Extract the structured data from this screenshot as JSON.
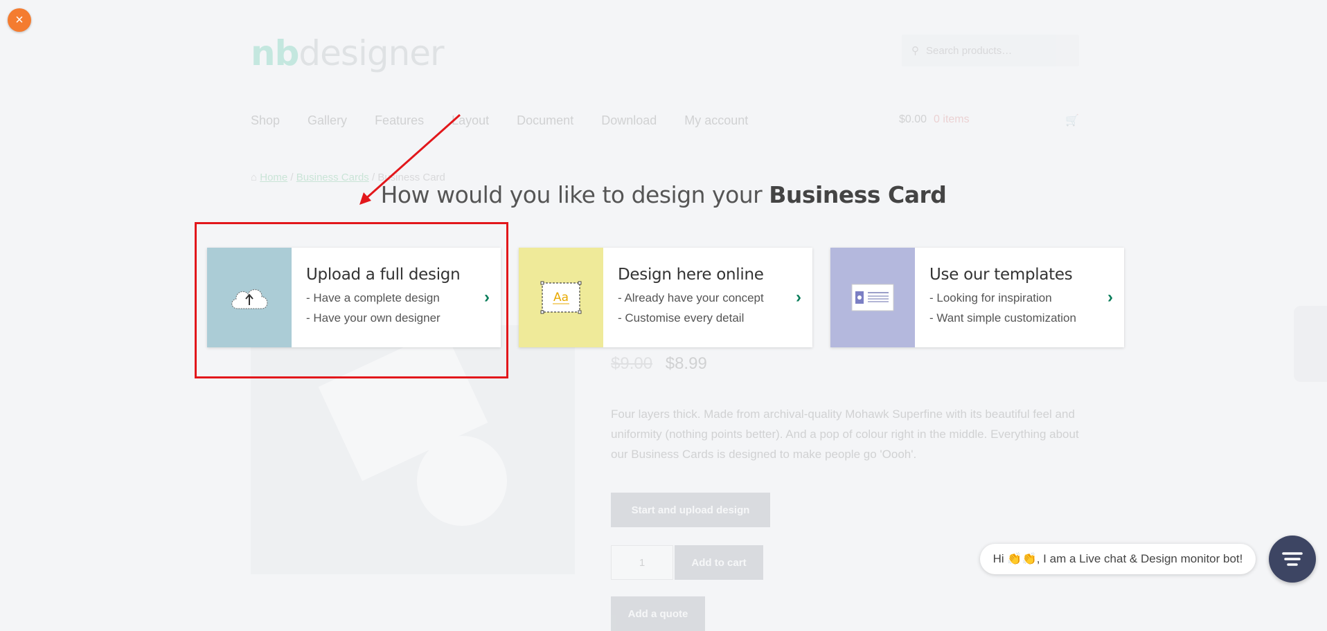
{
  "background_page": {
    "logo_mark": "nb",
    "logo_word": "designer",
    "search_placeholder": "Search products…",
    "nav": [
      "Shop",
      "Gallery",
      "Features",
      "Layout",
      "Document",
      "Download",
      "My account"
    ],
    "cart_total": "$0.00",
    "cart_items": "0 items",
    "breadcrumb": [
      "Home",
      "Business Cards",
      "Business Card"
    ],
    "price_old": "$9.00",
    "price_new": "$8.99",
    "description": "Four layers thick. Made from archival-quality Mohawk Superfine with its beautiful feel and uniformity (nothing points better). And a pop of colour right in the middle. Everything about our Business Cards is designed to make people go 'Oooh'.",
    "start_upload_label": "Start and upload design",
    "qty_value": "1",
    "add_to_cart_label": "Add to cart",
    "add_quote_label": "Add a quote"
  },
  "modal": {
    "close_label": "×",
    "heading_prefix": "How would you like to design your",
    "heading_strong": "Business Card",
    "options": [
      {
        "title": "Upload a full design",
        "line1": "- Have a complete design",
        "line2": "- Have your own designer",
        "icon": "cloud-upload-icon",
        "thumb_color": "#abccd6"
      },
      {
        "title": "Design here online",
        "line1": "- Already have your concept",
        "line2": "- Customise every detail",
        "icon": "text-frame-icon",
        "thumb_text": "Aa",
        "thumb_color": "#efea99"
      },
      {
        "title": "Use our templates",
        "line1": "- Looking for inspiration",
        "line2": "- Want simple customization",
        "icon": "template-card-icon",
        "thumb_color": "#b4b8dd"
      }
    ]
  },
  "chat": {
    "greeting_prefix": "Hi",
    "emoji": "👏👏",
    "greeting_suffix": ", I am a Live chat & Design monitor bot!"
  },
  "colors": {
    "close_button": "#f47c30",
    "highlight": "#e2171b",
    "chevron": "#0a7d5a",
    "chat_button": "#3d4563"
  }
}
